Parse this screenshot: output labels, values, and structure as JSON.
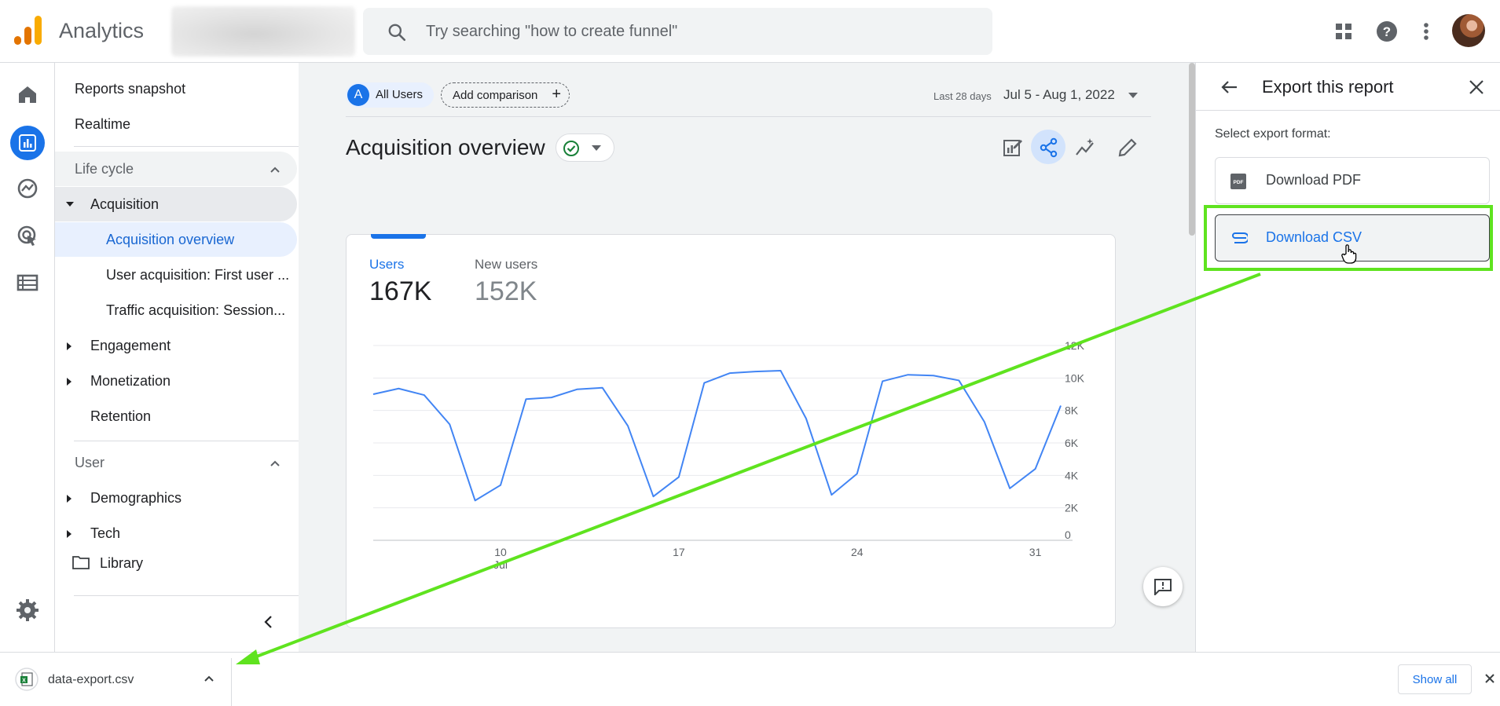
{
  "app": {
    "title": "Analytics"
  },
  "search": {
    "placeholder": "Try searching \"how to create funnel\""
  },
  "nav": {
    "items": [
      "Reports snapshot",
      "Realtime",
      "Life cycle",
      "Acquisition",
      "Acquisition overview",
      "User acquisition: First user ...",
      "Traffic acquisition: Session...",
      "Engagement",
      "Monetization",
      "Retention",
      "User",
      "Demographics",
      "Tech",
      "Library"
    ]
  },
  "main": {
    "segment_chip": "All Users",
    "segment_letter": "A",
    "add_comparison": "Add comparison",
    "date_prefix": "Last 28 days",
    "date_range": "Jul 5 - Aug 1, 2022",
    "heading": "Acquisition overview",
    "metrics": [
      {
        "label": "Users",
        "value": "167K"
      },
      {
        "label": "New users",
        "value": "152K"
      }
    ]
  },
  "chart_data": {
    "type": "line",
    "title": "",
    "xlabel": "",
    "ylabel": "",
    "ylim": [
      0,
      12000
    ],
    "y_ticks": [
      "0",
      "2K",
      "4K",
      "6K",
      "8K",
      "10K",
      "12K"
    ],
    "x_ticks": [
      {
        "day": 10,
        "label": "10",
        "sublabel": "Jul"
      },
      {
        "day": 17,
        "label": "17",
        "sublabel": ""
      },
      {
        "day": 24,
        "label": "24",
        "sublabel": ""
      },
      {
        "day": 31,
        "label": "31",
        "sublabel": ""
      }
    ],
    "x_days": [
      5,
      6,
      7,
      8,
      9,
      10,
      11,
      12,
      13,
      14,
      15,
      16,
      17,
      18,
      19,
      20,
      21,
      22,
      23,
      24,
      25,
      26,
      27,
      28,
      29,
      30,
      31,
      32
    ],
    "series": [
      {
        "color": "#4285f4",
        "values": [
          9000,
          9350,
          8950,
          7150,
          2450,
          3400,
          8700,
          8800,
          9300,
          9400,
          7050,
          2700,
          3900,
          9700,
          10300,
          10400,
          10450,
          7500,
          2800,
          4100,
          9800,
          10200,
          10150,
          9850,
          7300,
          3200,
          4400,
          8300
        ]
      }
    ]
  },
  "panel": {
    "title": "Export this report",
    "format_label": "Select export format:",
    "pdf_label": "Download PDF",
    "csv_label": "Download CSV"
  },
  "download_bar": {
    "file_name": "data-export.csv",
    "show_all": "Show all"
  },
  "colors": {
    "accent": "#1a73e8",
    "highlight": "#5fe31f",
    "line": "#4285f4"
  }
}
